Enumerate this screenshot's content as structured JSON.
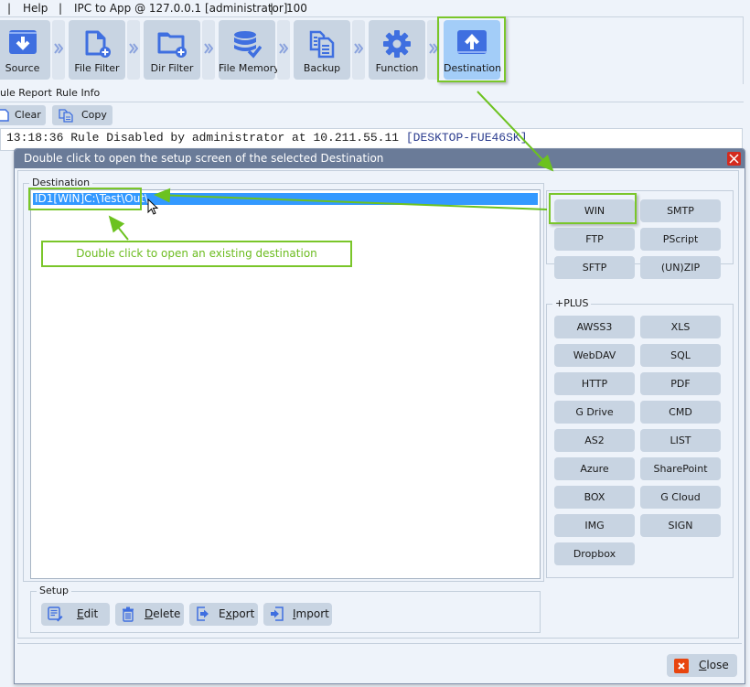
{
  "menubar": {
    "separator": "|",
    "help": "Help",
    "connection": "IPC to App @ 127.0.0.1 [administrator]",
    "count": "100"
  },
  "toolbar": {
    "items": [
      {
        "label": "Source",
        "icon": "download-icon"
      },
      {
        "label": "File Filter",
        "icon": "file-add-icon"
      },
      {
        "label": "Dir Filter",
        "icon": "folder-add-icon"
      },
      {
        "label": "File Memory",
        "icon": "database-check-icon"
      },
      {
        "label": "Backup",
        "icon": "copy-icon"
      },
      {
        "label": "Function",
        "icon": "gear-icon"
      },
      {
        "label": "Destination",
        "icon": "upload-icon",
        "active": true
      }
    ]
  },
  "subtabs": {
    "rule_report": "ule Report",
    "rule_info": "Rule Info"
  },
  "log_actions": {
    "clear": "Clear",
    "copy": "Copy"
  },
  "log": {
    "line": "13:18:36 Rule Disabled by administrator at 10.211.55.11 ",
    "host": "[DESKTOP-FUE46SK]"
  },
  "dialog": {
    "title": "Double click to open the setup screen of the selected Destination",
    "destination_group": "Destination",
    "destinations": [
      {
        "text": "ID1[WIN]C:\\Test\\Out\\",
        "selected": true
      }
    ],
    "basic_buttons": [
      "WIN",
      "SMTP",
      "FTP",
      "PScript",
      "SFTP",
      "(UN)ZIP"
    ],
    "plus_group": "+PLUS",
    "plus_buttons": [
      "AWSS3",
      "XLS",
      "WebDAV",
      "SQL",
      "HTTP",
      "PDF",
      "G Drive",
      "CMD",
      "AS2",
      "LIST",
      "Azure",
      "SharePoint",
      "BOX",
      "G Cloud",
      "IMG",
      "SIGN",
      "Dropbox"
    ],
    "setup_group": "Setup",
    "setup": {
      "edit_u": "E",
      "edit_rest": "dit",
      "delete_u": "D",
      "delete_rest": "elete",
      "export_a": "E",
      "export_u": "x",
      "export_rest": "port",
      "import_u": "I",
      "import_rest": "mport"
    },
    "close_u": "C",
    "close_rest": "lose"
  },
  "annotations": {
    "existing_hint": "Double click to open an existing destination"
  },
  "colors": {
    "accent_green": "#7ac62a",
    "selection_blue": "#3399ff",
    "title_bar": "#6a7b98",
    "button_bg": "#c8d4e2",
    "icon_blue": "#3f6fe0",
    "close_red": "#d42a1e"
  }
}
